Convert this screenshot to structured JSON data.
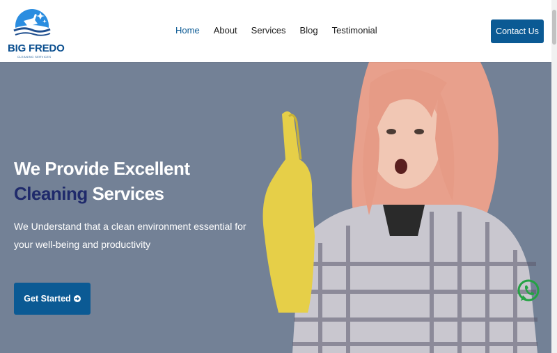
{
  "brand": {
    "name": "BIG FREDO",
    "tagline": "CLEANING SERVICES",
    "colors": {
      "primary": "#0b5a94",
      "accent_text": "#1f2a6b",
      "hero_bg": "#738196",
      "whatsapp": "#25a244"
    }
  },
  "nav": {
    "items": [
      {
        "label": "Home",
        "active": true
      },
      {
        "label": "About",
        "active": false
      },
      {
        "label": "Services",
        "active": false
      },
      {
        "label": "Blog",
        "active": false
      },
      {
        "label": "Testimonial",
        "active": false
      }
    ],
    "contact_label": "Contact Us"
  },
  "hero": {
    "title_line1": "We Provide Excellent",
    "title_accent": "Cleaning",
    "title_rest": "Services",
    "subtitle": "We Understand that a clean environment essential for your well-being and productivity",
    "cta_label": "Get Started",
    "cta_icon": "arrow-right-circle-icon"
  },
  "floating": {
    "icon": "whatsapp-icon"
  }
}
